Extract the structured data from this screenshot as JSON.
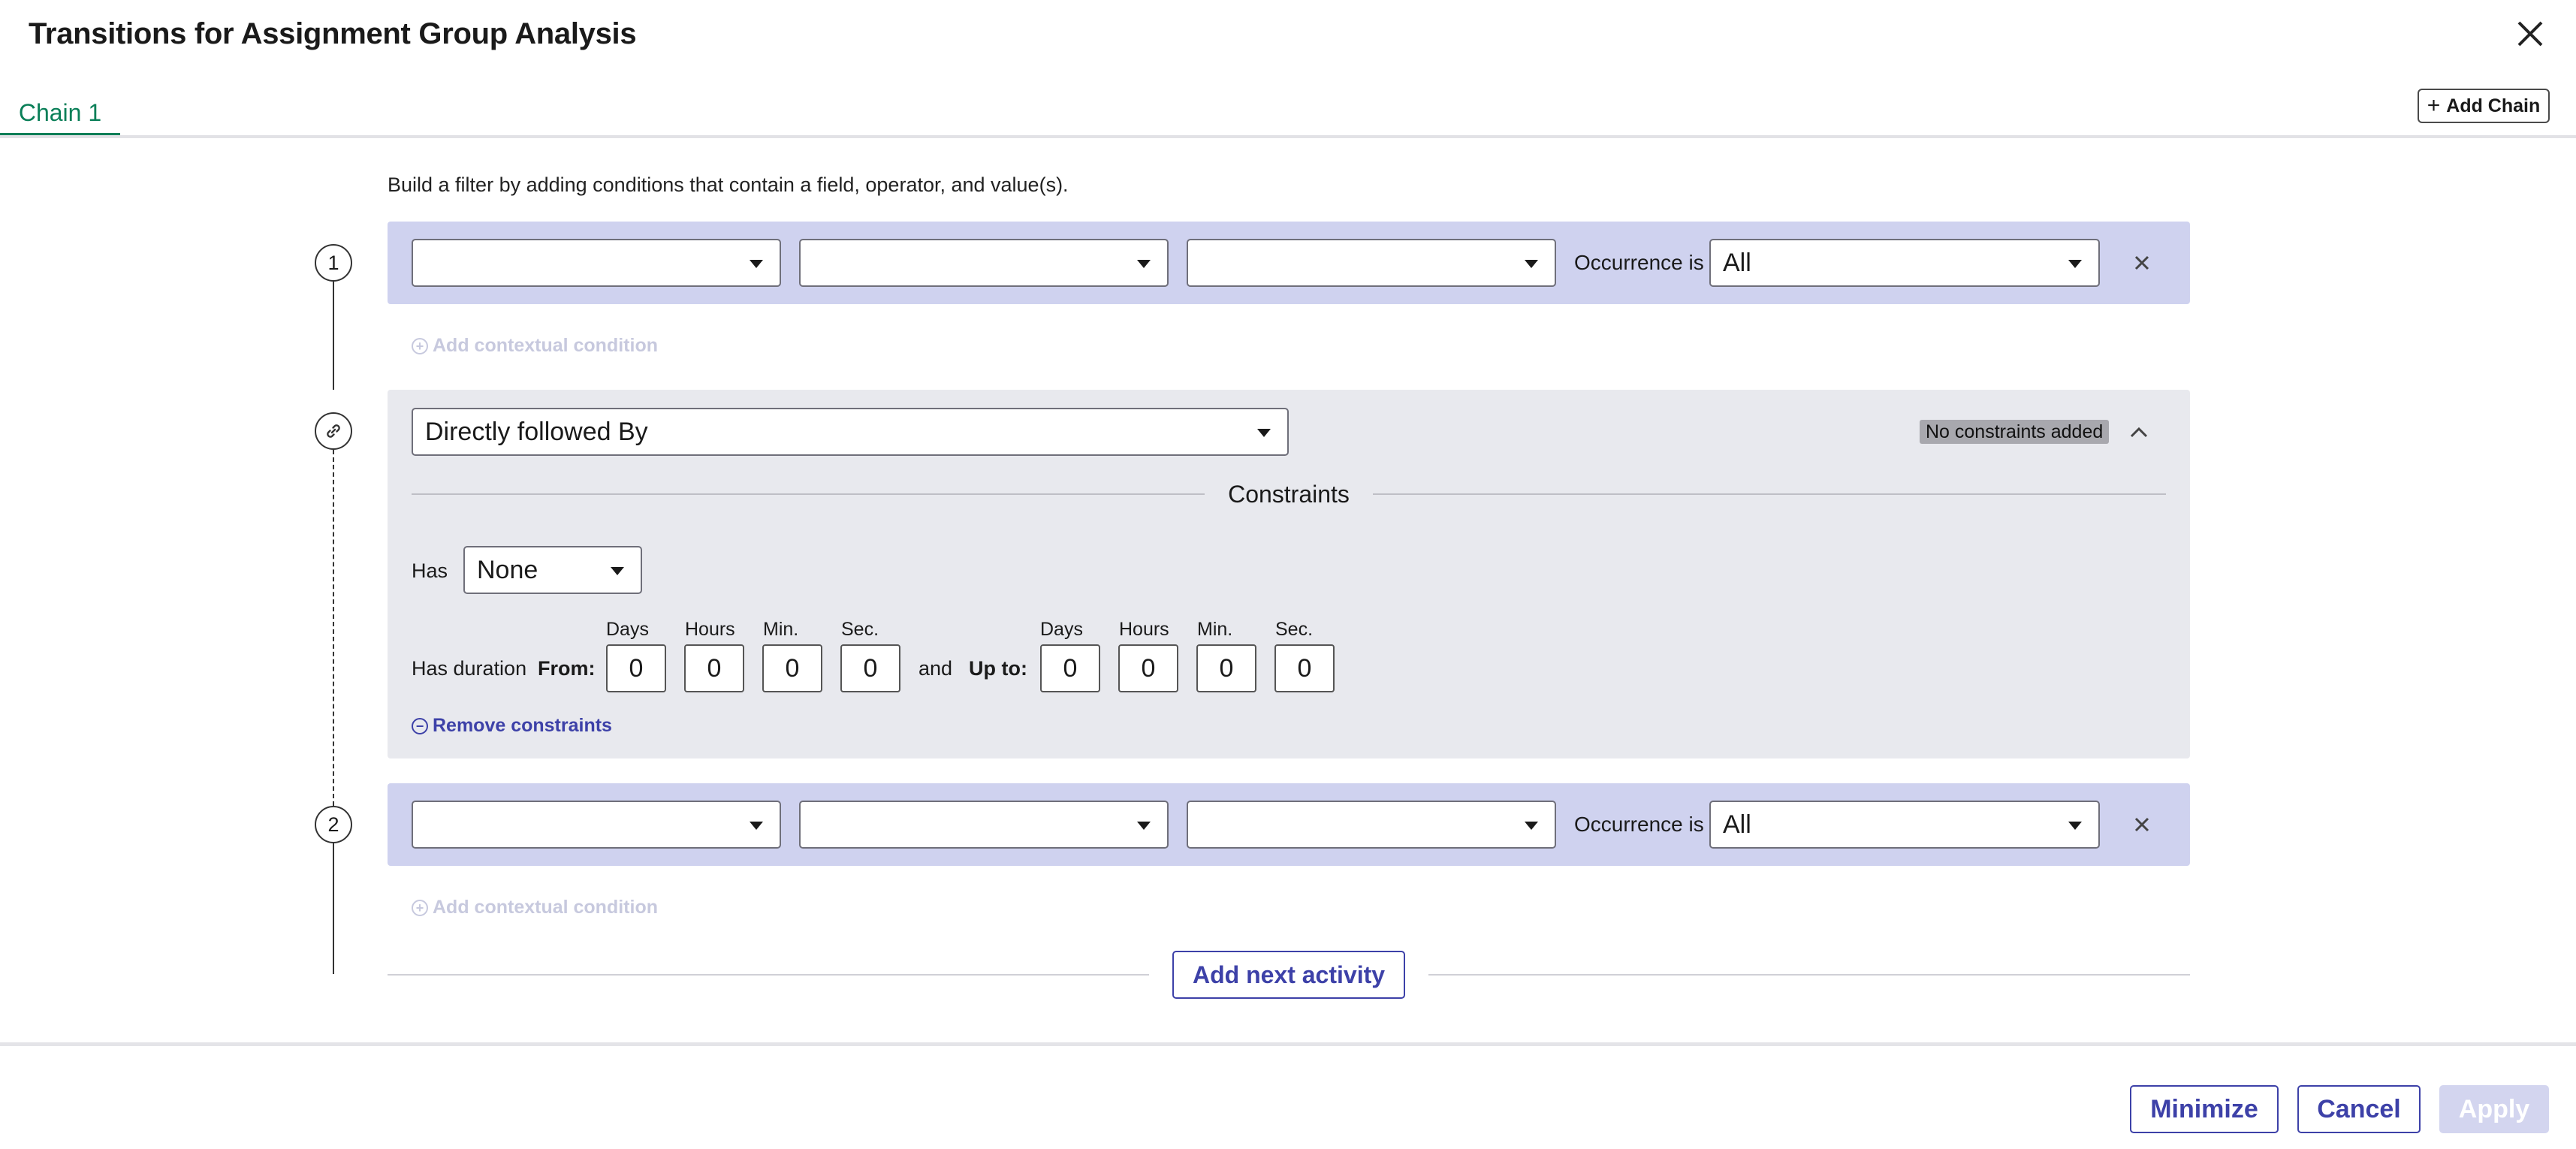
{
  "header": {
    "title": "Transitions for Assignment Group Analysis"
  },
  "tabs": [
    {
      "label": "Chain 1"
    }
  ],
  "add_chain_label": "Add Chain",
  "instructions": "Build a filter by adding conditions that contain a field, operator, and value(s).",
  "steps": [
    {
      "number": "1",
      "occurrence_label": "Occurrence is",
      "occurrence_value": "All",
      "add_context_label": "Add contextual condition"
    },
    {
      "number": "2",
      "occurrence_label": "Occurrence is",
      "occurrence_value": "All",
      "add_context_label": "Add contextual condition"
    }
  ],
  "link": {
    "relation": "Directly followed By",
    "badge": "No constraints added",
    "constraints_title": "Constraints",
    "has_label": "Has",
    "has_value": "None",
    "has_duration_label": "Has duration",
    "from_label": "From:",
    "and_label": "and",
    "upto_label": "Up to:",
    "units": [
      "Days",
      "Hours",
      "Min.",
      "Sec."
    ],
    "from_values": [
      "0",
      "0",
      "0",
      "0"
    ],
    "upto_values": [
      "0",
      "0",
      "0",
      "0"
    ],
    "remove_label": "Remove constraints"
  },
  "add_next_label": "Add next activity",
  "footer": {
    "minimize": "Minimize",
    "cancel": "Cancel",
    "apply": "Apply"
  },
  "colors": {
    "accent": "#3d41a8",
    "tab_active": "#0a7f58",
    "condition_bg": "#cfd2ef",
    "link_bg": "#e8e9ee"
  }
}
